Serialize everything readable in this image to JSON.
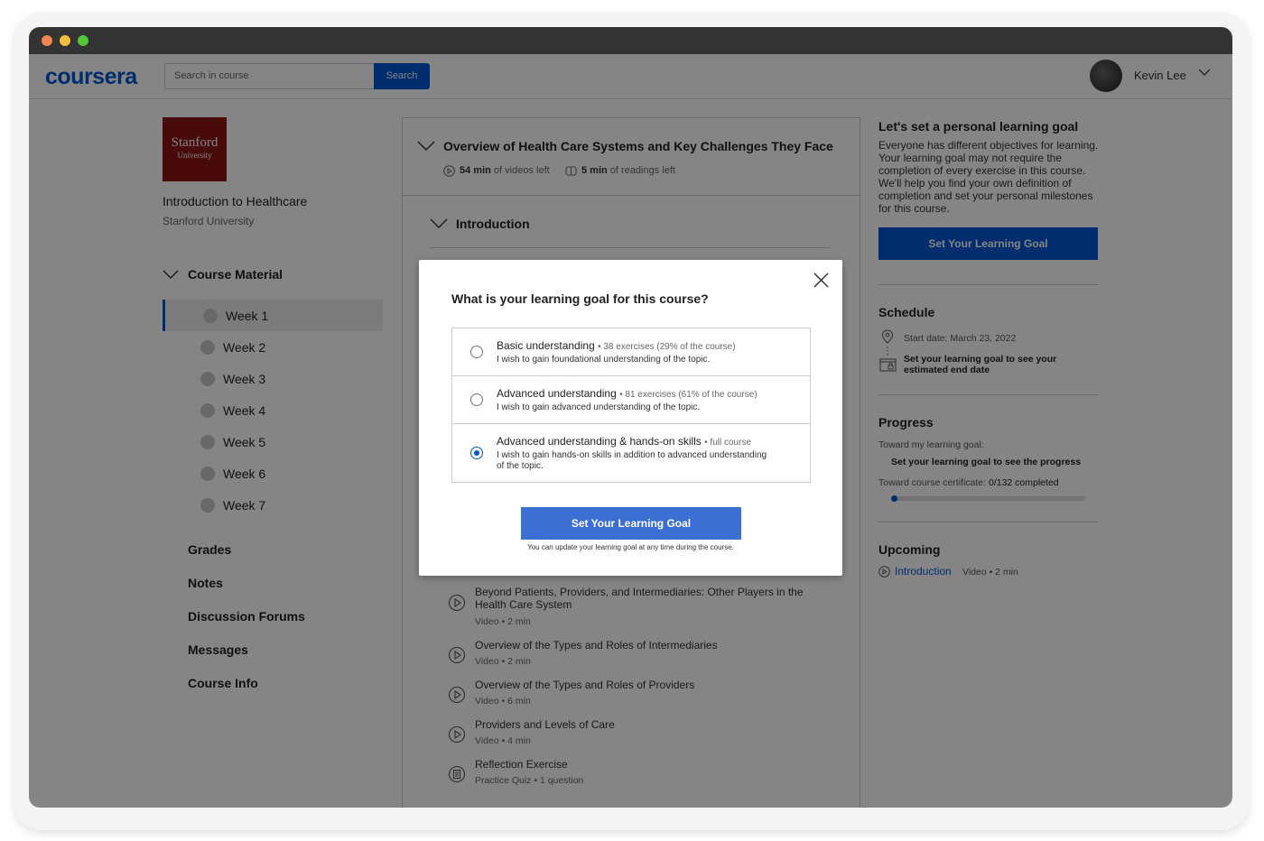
{
  "app": {
    "logo": "coursera"
  },
  "search": {
    "placeholder": "Search in course",
    "button_label": "Search"
  },
  "user": {
    "name": "Kevin Lee"
  },
  "course": {
    "logo_line1": "Stanford",
    "logo_line2": "University",
    "title": "Introduction to Healthcare",
    "university": "Stanford University"
  },
  "sidebar": {
    "section_label": "Course Material",
    "weeks": [
      "Week 1",
      "Week 2",
      "Week 3",
      "Week 4",
      "Week 5",
      "Week 6",
      "Week 7"
    ],
    "active_week": "Week 1",
    "links": [
      "Grades",
      "Notes",
      "Discussion Forums",
      "Messages",
      "Course Info"
    ]
  },
  "module": {
    "title": "Overview of Health Care Systems and Key Challenges They Face",
    "videos_bold": "54 min",
    "videos_text": "of videos left",
    "readings_bold": "5 min",
    "readings_text": "of readings left",
    "section": "Introduction",
    "items": [
      {
        "title": "Beyond Patients, Providers, and Intermediaries: Other Players in the Health Care System",
        "sub": "Video • 2 min",
        "icon": "play-icon"
      },
      {
        "title": "Overview of the Types and Roles of Intermediaries",
        "sub": "Video • 2 min",
        "icon": "play-icon"
      },
      {
        "title": "Overview of the Types and Roles of Providers",
        "sub": "Video • 6 min",
        "icon": "play-icon"
      },
      {
        "title": "Providers and Levels of Care",
        "sub": "Video • 4 min",
        "icon": "play-icon"
      },
      {
        "title": "Reflection Exercise",
        "sub": "Practice Quiz • 1 question",
        "icon": "quiz-icon"
      }
    ]
  },
  "goal_panel": {
    "title": "Let's set a personal learning goal",
    "body": "Everyone has different objectives for learning. Your learning goal may not require the completion of every exercise in this course. We'll help you find your own definition of completion and set your personal milestones for this course.",
    "button": "Set Your Learning Goal"
  },
  "schedule": {
    "title": "Schedule",
    "start": "Start date: March 23, 2022",
    "end_prompt": "Set your learning goal to see your estimated end date"
  },
  "progress": {
    "title": "Progress",
    "goal_label": "Toward my learning goal:",
    "goal_prompt": "Set your learning goal to see the progress",
    "cert_label": "Toward course certificate:",
    "cert_value": "0/132 completed",
    "fraction": 0.0
  },
  "upcoming": {
    "title": "Upcoming",
    "link": "Introduction",
    "meta": "Video • 2 min"
  },
  "modal": {
    "title": "What is your learning goal for this course?",
    "options": [
      {
        "title": "Basic understanding",
        "detail": "• 38 exercises (29% of the course)",
        "desc": "I wish to gain foundational understanding of the topic.",
        "selected": false
      },
      {
        "title": "Advanced understanding",
        "detail": "• 81 exercises (61% of the course)",
        "desc": "I wish to gain advanced understanding of the topic.",
        "selected": false
      },
      {
        "title": "Advanced understanding & hands-on skills",
        "detail": "• full course",
        "desc": "I wish to gain hands-on skills in addition to advanced understanding of the topic.",
        "selected": true
      }
    ],
    "button": "Set Your Learning Goal",
    "note": "You can update your learning goal at any time during the course."
  },
  "colors": {
    "brand": "#0056d2",
    "stanford": "#8c1515",
    "modal_button": "#3c6fd4"
  }
}
